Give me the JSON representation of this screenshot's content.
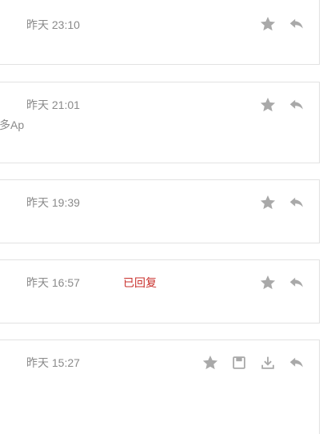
{
  "messages": [
    {
      "time": "昨天 23:10",
      "snippet": "",
      "status": "",
      "actions": [
        "star-icon",
        "reply-icon"
      ]
    },
    {
      "time": "昨天 21:01",
      "snippet": "多Ap",
      "status": "",
      "actions": [
        "star-icon",
        "reply-icon"
      ]
    },
    {
      "time": "昨天 19:39",
      "snippet": "",
      "status": "",
      "actions": [
        "star-icon",
        "reply-icon"
      ]
    },
    {
      "time": "昨天 16:57",
      "snippet": "",
      "status": "已回复",
      "actions": [
        "star-icon",
        "reply-icon"
      ]
    },
    {
      "time": "昨天 15:27",
      "snippet": "",
      "status": "",
      "actions": [
        "star-icon",
        "save-icon",
        "download-icon",
        "reply-icon"
      ]
    }
  ],
  "colors": {
    "border": "#e2e2e2",
    "text_muted": "#8a8a8a",
    "icon": "#a9a9a9",
    "status_replied": "#c9302c"
  }
}
